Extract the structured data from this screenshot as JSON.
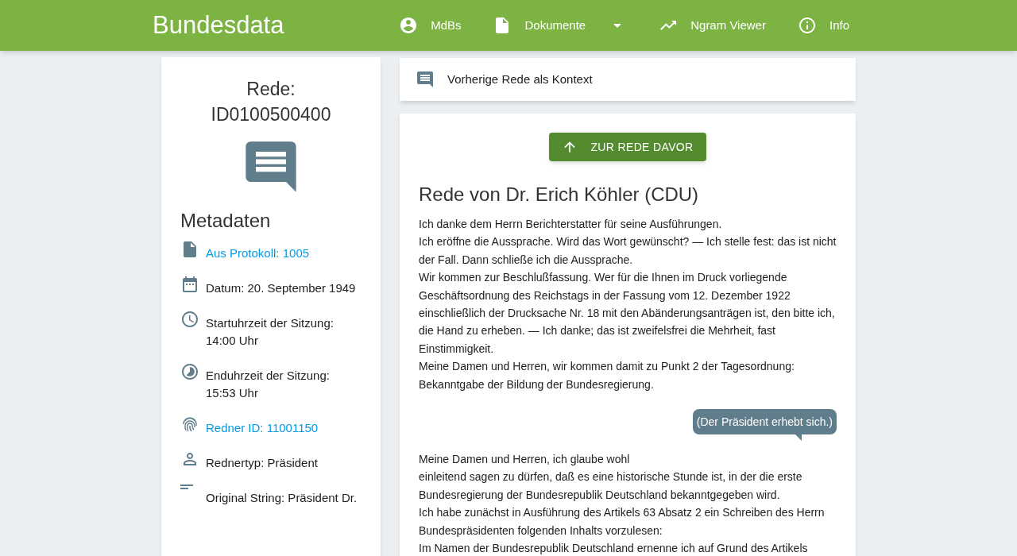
{
  "app_bar": {
    "title": "Bundesdata",
    "nav": [
      {
        "label": "MdBs",
        "dropdown": false
      },
      {
        "label": "Dokumente",
        "dropdown": true
      },
      {
        "label": "Ngram Viewer",
        "dropdown": false
      },
      {
        "label": "Info",
        "dropdown": false
      }
    ]
  },
  "sidebar": {
    "title": "Rede: ID0100500400",
    "section": "Metadaten",
    "items": [
      {
        "kind": "link",
        "text": "Aus Protokoll: 1005"
      },
      {
        "kind": "text",
        "text": "Datum: 20. September 1949"
      },
      {
        "kind": "text",
        "text": "Startuhrzeit der Sitzung: 14:00 Uhr"
      },
      {
        "kind": "text",
        "text": "Enduhrzeit der Sitzung: 15:53 Uhr"
      },
      {
        "kind": "link",
        "text": "Redner ID: 11001150"
      },
      {
        "kind": "text",
        "text": "Rednertyp: Präsident"
      },
      {
        "kind": "text",
        "text": "Original String: Präsident Dr."
      }
    ]
  },
  "context_bar": {
    "label": "Vorherige Rede als Kontext"
  },
  "speech": {
    "button": "ZUR REDE DAVOR",
    "title": "Rede von Dr. Erich Köhler (CDU)",
    "blocks": [
      {
        "kind": "paragraph",
        "text": "Ich danke dem Herrn Berichterstatter für seine Ausführungen."
      },
      {
        "kind": "paragraph",
        "text": "Ich eröffne die Aussprache. Wird das Wort gewünscht? — Ich stelle fest: das ist nicht der Fall. Dann schließe ich die Aussprache."
      },
      {
        "kind": "paragraph",
        "text": "Wir kommen zur Beschlußfassung. Wer für die Ihnen im Druck vorliegende Geschäftsordnung des Reichstags in der Fassung vom 12. Dezember 1922 einschließlich der Drucksache Nr. 18 mit den Abänderungsanträgen ist, den bitte ich, die Hand zu erheben. — Ich danke; das ist zweifelsfrei die Mehrheit, fast Einstimmigkeit."
      },
      {
        "kind": "paragraph",
        "text": "Meine Damen und Herren, wir kommen damit zu Punkt 2 der Tagesordnung: Bekanntgabe der Bildung der Bundesregierung."
      },
      {
        "kind": "comment",
        "text": "(Der Präsident erhebt sich.)"
      },
      {
        "kind": "paragraph",
        "text": "Meine Damen und Herren, ich glaube wohl"
      },
      {
        "kind": "paragraph",
        "text": "einleitend sagen zu dürfen, daß es eine historische Stunde ist, in der die erste Bundesregierung der Bundesrepublik Deutschland bekanntgegeben wird."
      },
      {
        "kind": "paragraph",
        "text": "Ich habe zunächst in Ausführung des Artikels 63 Absatz 2 ein Schreiben des Herrn Bundespräsidenten folgenden Inhalts vorzulesen:"
      },
      {
        "kind": "paragraph",
        "text": "Im Namen der Bundesrepublik Deutschland ernenne ich auf Grund des Artikels"
      }
    ]
  }
}
